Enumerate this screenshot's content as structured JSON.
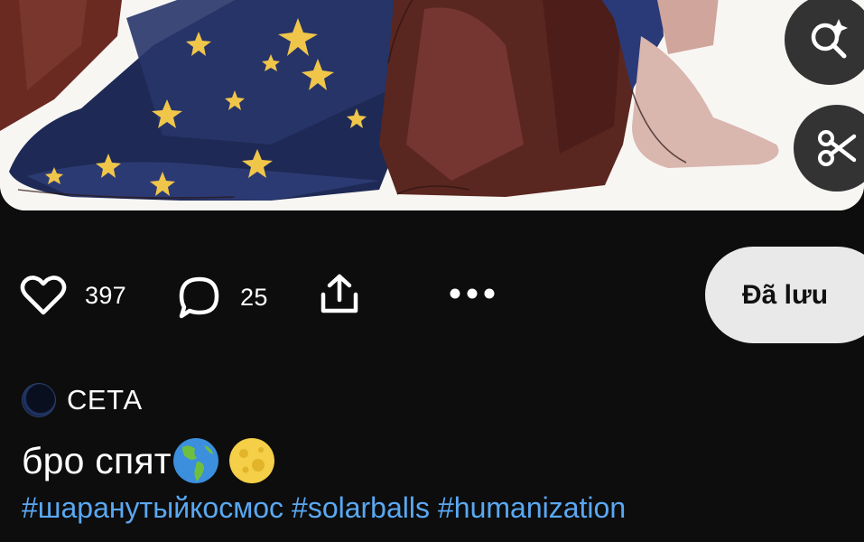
{
  "pin": {
    "likes": "397",
    "comments": "25",
    "saved_label": "Đã lưu"
  },
  "author": {
    "name": "СЕТА"
  },
  "post": {
    "title": "бро спят",
    "emojis": [
      "earth-americas-emoji",
      "full-moon-emoji"
    ],
    "tags": [
      "#шаранутыйкосмос",
      "#solarballs",
      "#humanization"
    ]
  },
  "colors": {
    "background": "#0d0d0d",
    "saved_button": "#e9e9e9",
    "float_button": "#333333",
    "hashtag": "#5aa8f2"
  },
  "icons": [
    "heart-icon",
    "comment-icon",
    "share-icon",
    "more-icon",
    "visual-search-icon",
    "scissors-icon"
  ]
}
